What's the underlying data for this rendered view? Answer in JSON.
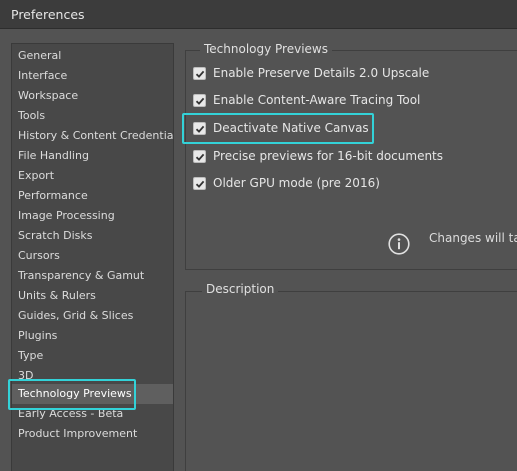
{
  "window": {
    "title": "Preferences"
  },
  "sidebar": {
    "items": [
      {
        "label": "General"
      },
      {
        "label": "Interface"
      },
      {
        "label": "Workspace"
      },
      {
        "label": "Tools"
      },
      {
        "label": "History & Content Credentials"
      },
      {
        "label": "File Handling"
      },
      {
        "label": "Export"
      },
      {
        "label": "Performance"
      },
      {
        "label": "Image Processing"
      },
      {
        "label": "Scratch Disks"
      },
      {
        "label": "Cursors"
      },
      {
        "label": "Transparency & Gamut"
      },
      {
        "label": "Units & Rulers"
      },
      {
        "label": "Guides, Grid & Slices"
      },
      {
        "label": "Plugins"
      },
      {
        "label": "Type"
      },
      {
        "label": "3D"
      },
      {
        "label": "Technology Previews"
      },
      {
        "label": "Early Access - Beta"
      },
      {
        "label": "Product Improvement"
      }
    ],
    "selected": "Technology Previews"
  },
  "tech_previews": {
    "title": "Technology Previews",
    "options": [
      {
        "label": "Enable Preserve Details 2.0 Upscale",
        "checked": true
      },
      {
        "label": "Enable Content-Aware Tracing Tool",
        "checked": true
      },
      {
        "label": "Deactivate Native Canvas",
        "checked": true
      },
      {
        "label": "Precise previews for 16-bit documents",
        "checked": true
      },
      {
        "label": "Older GPU mode (pre 2016)",
        "checked": true
      }
    ],
    "info_text": "Changes will take effect the next time you start Photoshop."
  },
  "description": {
    "title": "Description"
  },
  "colors": {
    "highlight": "#33d2d8",
    "background": "#535353"
  }
}
